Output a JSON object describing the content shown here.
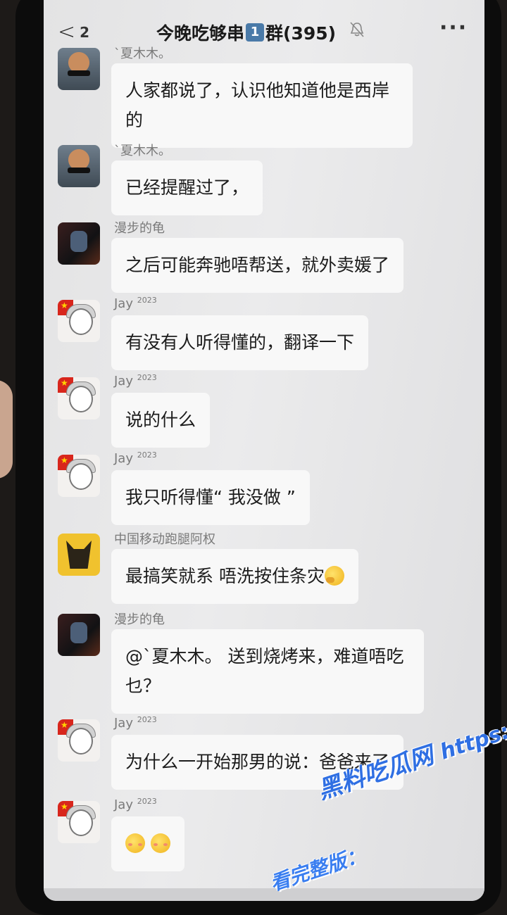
{
  "header": {
    "back_badge": "2",
    "title_pre": "今晚吃够串",
    "title_emoji": "1",
    "title_post": "群(395)",
    "more": "···"
  },
  "messages": [
    {
      "name": "`夏木木。",
      "text": "人家都说了，认识他知道他是西岸的",
      "avatar": "boy"
    },
    {
      "name": "`夏木木。",
      "text": "已经提醒过了，",
      "avatar": "boy"
    },
    {
      "name": "漫步的龟",
      "text": "之后可能奔驰唔帮送，就外卖媛了",
      "avatar": "dark"
    },
    {
      "name": "Jay",
      "tag": "2023",
      "text": "有没有人听得懂的，翻译一下",
      "avatar": "anime"
    },
    {
      "name": "Jay",
      "tag": "2023",
      "text": "说的什么",
      "avatar": "anime"
    },
    {
      "name": "Jay",
      "tag": "2023",
      "text": "我只听得懂“ 我没做 ”",
      "avatar": "anime"
    },
    {
      "name": "中国移动跑腿阿权",
      "text": "最搞笑就系  唔洗按住条灾",
      "emoji": "thinking-face",
      "avatar": "fox"
    },
    {
      "name": "漫步的龟",
      "text": "@`夏木木。 送到烧烤来，难道唔吃乜？",
      "avatar": "dark"
    },
    {
      "name": "Jay",
      "tag": "2023",
      "text": "为什么一开始那男的说：爸爸来了",
      "avatar": "anime"
    },
    {
      "name": "Jay",
      "tag": "2023",
      "text": "",
      "emoji": "blushing-faces",
      "avatar": "anime"
    }
  ],
  "watermark": {
    "line1": "黑料吃瓜网",
    "url": "https://hlcgw.co",
    "line2": "看完整版："
  }
}
